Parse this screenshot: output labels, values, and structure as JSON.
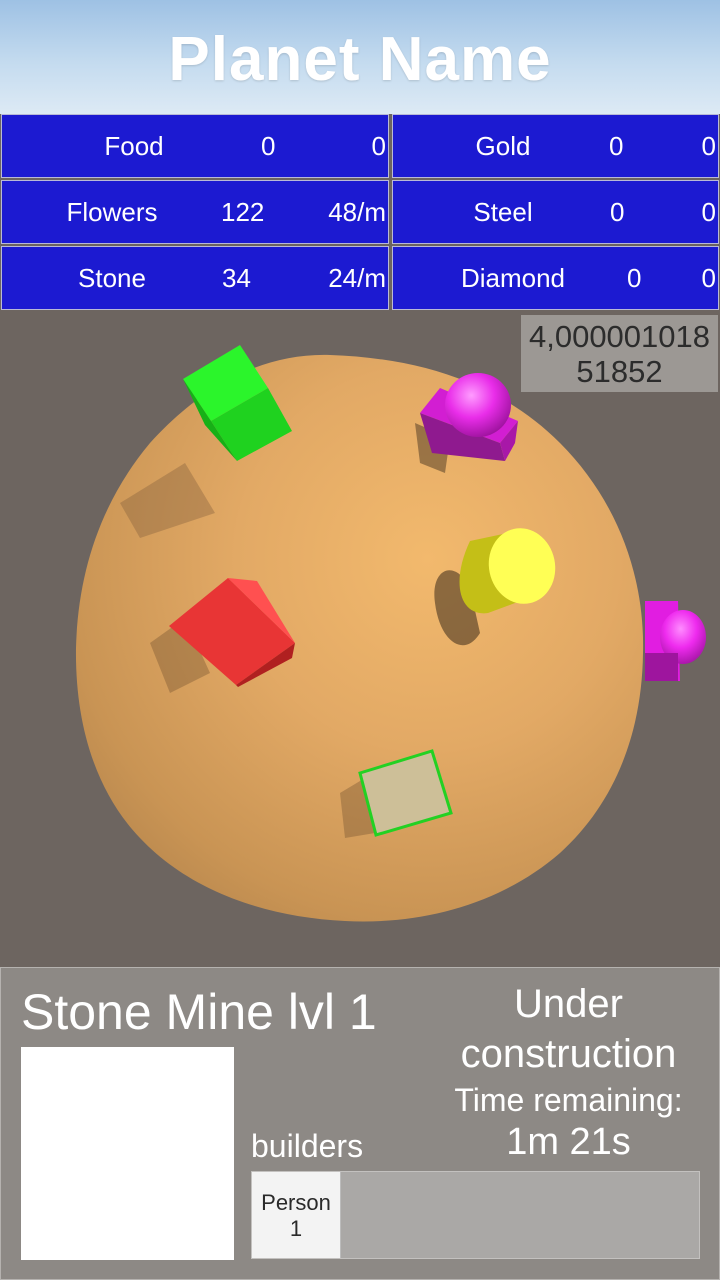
{
  "planet": {
    "name": "Planet Name"
  },
  "resources": [
    {
      "name": "Food",
      "amount": "0",
      "rate": "0"
    },
    {
      "name": "Gold",
      "amount": "0",
      "rate": "0"
    },
    {
      "name": "Flowers",
      "amount": "122",
      "rate": "48/m"
    },
    {
      "name": "Steel",
      "amount": "0",
      "rate": "0"
    },
    {
      "name": "Stone",
      "amount": "34",
      "rate": "24/m"
    },
    {
      "name": "Diamond",
      "amount": "0",
      "rate": "0"
    }
  ],
  "zoom_readout": {
    "line1": "4,000001018",
    "line2": "51852"
  },
  "building": {
    "name": "Stone Mine lvl 1",
    "status_line1": "Under",
    "status_line2": "construction",
    "time_label": "Time remaining:",
    "time_value": "1m 21s",
    "builders_label": "builders",
    "builder_slots": [
      {
        "line1": "Person",
        "line2": "1"
      }
    ]
  },
  "colors": {
    "resource_panel": "#1c1ad1",
    "planet": "#e2a965",
    "sky": "#9ec1e4",
    "ground": "#6d6560",
    "info_panel": "#8d8985"
  },
  "scene_objects": [
    {
      "kind": "green-cube"
    },
    {
      "kind": "magenta-dome-building"
    },
    {
      "kind": "yellow-cylinder"
    },
    {
      "kind": "red-cube"
    },
    {
      "kind": "selected-beige-tile"
    },
    {
      "kind": "magenta-dome-building-edge"
    }
  ]
}
